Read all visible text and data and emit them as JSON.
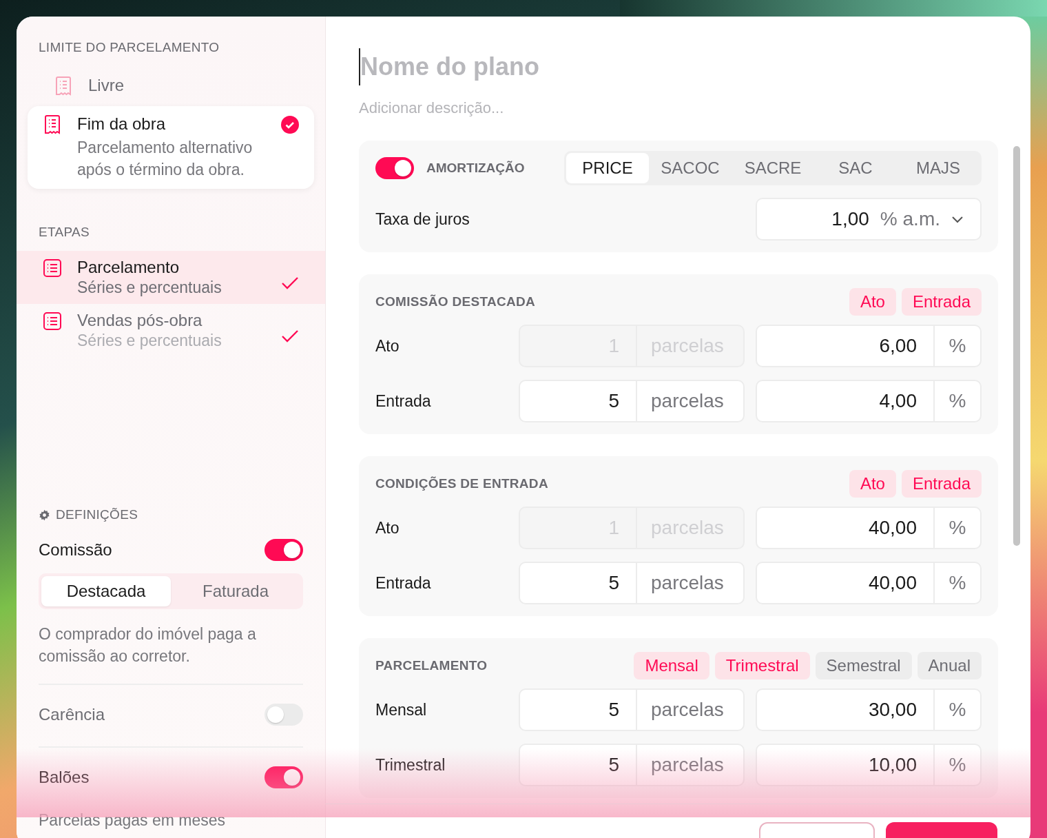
{
  "sidebar": {
    "limit_title": "LIMITE DO PARCELAMENTO",
    "limit_options": [
      {
        "title": "Livre",
        "selected": false
      },
      {
        "title": "Fim da obra",
        "description": "Parcelamento alternativo após o término da obra.",
        "selected": true
      }
    ],
    "steps_title": "ETAPAS",
    "steps": [
      {
        "title": "Parcelamento",
        "subtitle": "Séries e percentuais",
        "selected": true,
        "done": true
      },
      {
        "title": "Vendas pós-obra",
        "subtitle": "Séries e percentuais",
        "selected": false,
        "done": true
      }
    ],
    "settings_title": "DEFINIÇÕES",
    "settings": [
      {
        "label": "Comissão",
        "on": true,
        "options": [
          {
            "label": "Destacada",
            "selected": true
          },
          {
            "label": "Faturada",
            "selected": false
          }
        ],
        "description": "O comprador do imóvel paga a comissão ao corretor."
      },
      {
        "label": "Carência",
        "on": false
      },
      {
        "label": "Balões",
        "on": true,
        "description": "Parcelas pagas em meses"
      }
    ]
  },
  "main": {
    "title_placeholder": "Nome do plano",
    "description_placeholder": "Adicionar descrição...",
    "amortization": {
      "on": true,
      "label": "AMORTIZAÇÃO",
      "systems": [
        {
          "label": "PRICE",
          "selected": true
        },
        {
          "label": "SACOC",
          "selected": false
        },
        {
          "label": "SACRE",
          "selected": false
        },
        {
          "label": "SAC",
          "selected": false
        },
        {
          "label": "MAJS",
          "selected": false
        }
      ],
      "rate_label": "Taxa de juros",
      "rate_value": "1,00",
      "rate_unit": "% a.m."
    },
    "sections": [
      {
        "title": "COMISSÃO DESTACADA",
        "chips": [
          {
            "label": "Ato",
            "on": true
          },
          {
            "label": "Entrada",
            "on": true
          }
        ],
        "rows": [
          {
            "label": "Ato",
            "count": "1",
            "count_unit": "parcelas",
            "disabled": true,
            "percent": "6,00",
            "percent_unit": "%"
          },
          {
            "label": "Entrada",
            "count": "5",
            "count_unit": "parcelas",
            "disabled": false,
            "percent": "4,00",
            "percent_unit": "%"
          }
        ]
      },
      {
        "title": "CONDIÇÕES DE ENTRADA",
        "chips": [
          {
            "label": "Ato",
            "on": true
          },
          {
            "label": "Entrada",
            "on": true
          }
        ],
        "rows": [
          {
            "label": "Ato",
            "count": "1",
            "count_unit": "parcelas",
            "disabled": true,
            "percent": "40,00",
            "percent_unit": "%"
          },
          {
            "label": "Entrada",
            "count": "5",
            "count_unit": "parcelas",
            "disabled": false,
            "percent": "40,00",
            "percent_unit": "%"
          }
        ]
      },
      {
        "title": "PARCELAMENTO",
        "chips": [
          {
            "label": "Mensal",
            "on": true
          },
          {
            "label": "Trimestral",
            "on": true
          },
          {
            "label": "Semestral",
            "on": false
          },
          {
            "label": "Anual",
            "on": false
          }
        ],
        "rows": [
          {
            "label": "Mensal",
            "count": "5",
            "count_unit": "parcelas",
            "disabled": false,
            "percent": "30,00",
            "percent_unit": "%"
          },
          {
            "label": "Trimestral",
            "count": "5",
            "count_unit": "parcelas",
            "disabled": false,
            "percent": "10,00",
            "percent_unit": "%"
          }
        ]
      }
    ]
  },
  "footer": {
    "buttons": [
      {
        "kind": "secondary"
      },
      {
        "kind": "primary"
      }
    ]
  }
}
